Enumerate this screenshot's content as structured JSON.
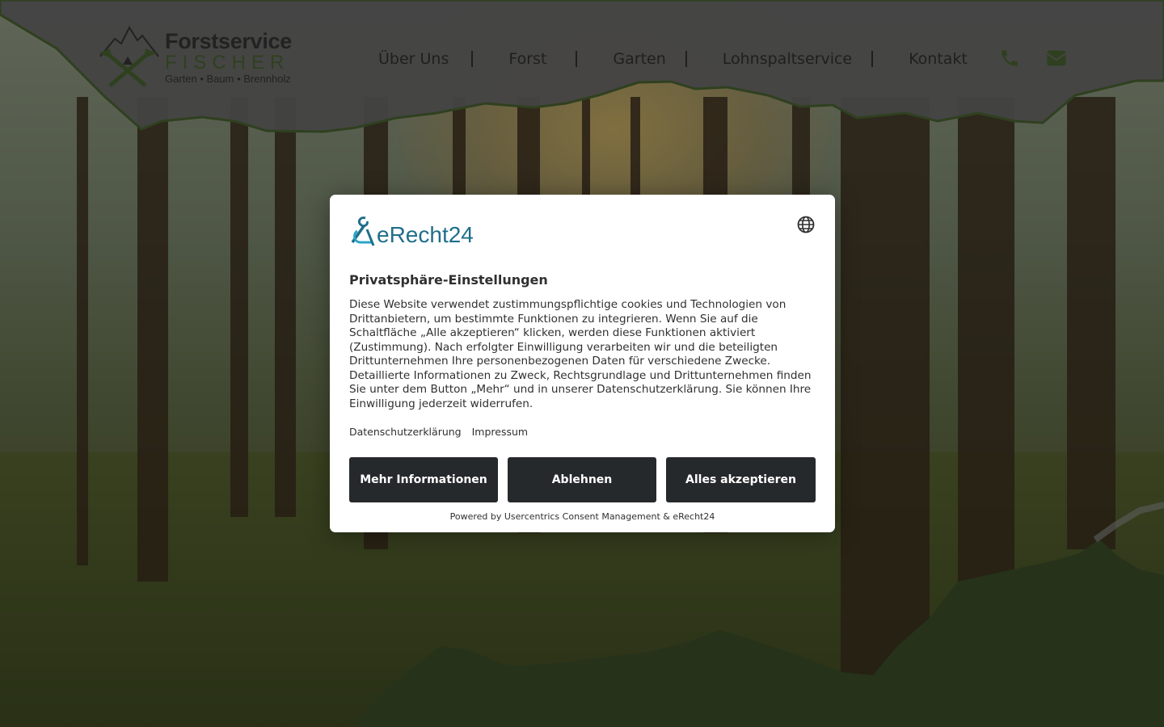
{
  "logo": {
    "title": "Forstservice",
    "subtitle": "FISCHER",
    "tagline": "Garten • Baum • Brennholz"
  },
  "nav": {
    "items": [
      "Über Uns",
      "Forst",
      "Garten",
      "Lohnspaltservice",
      "Kontakt"
    ]
  },
  "icons": {
    "phone": "phone-icon",
    "mail": "envelope-icon"
  },
  "colors": {
    "brand_green": "#5b7c3c",
    "dark_green": "#4a6133",
    "button_dark": "#26292c",
    "erecht_blue": "#1f6e8a"
  },
  "consent": {
    "brand": "eRecht24",
    "title": "Privatsphäre-Einstellungen",
    "body": "Diese Website verwendet zustimmungspflichtige cookies und Technologien von Drittanbietern, um bestimmte Funktionen zu integrieren. Wenn Sie auf die Schaltfläche „Alle akzeptieren“ klicken, werden diese Funktionen aktiviert (Zustimmung). Nach erfolgter Einwilligung verarbeiten wir und die beteiligten Drittunternehmen Ihre personenbezogenen Daten für verschiedene Zwecke. Detaillierte Informationen zu Zweck, Rechtsgrundlage und Drittunternehmen finden Sie unter dem Button „Mehr“ und in unserer Datenschutzerklärung. Sie können Ihre Einwilligung jederzeit widerrufen.",
    "links": {
      "privacy": "Datenschutzerklärung",
      "imprint": "Impressum"
    },
    "buttons": {
      "more": "Mehr Informationen",
      "deny": "Ablehnen",
      "accept": "Alles akzeptieren"
    },
    "powered": "Powered by Usercentrics Consent Management & eRecht24"
  }
}
